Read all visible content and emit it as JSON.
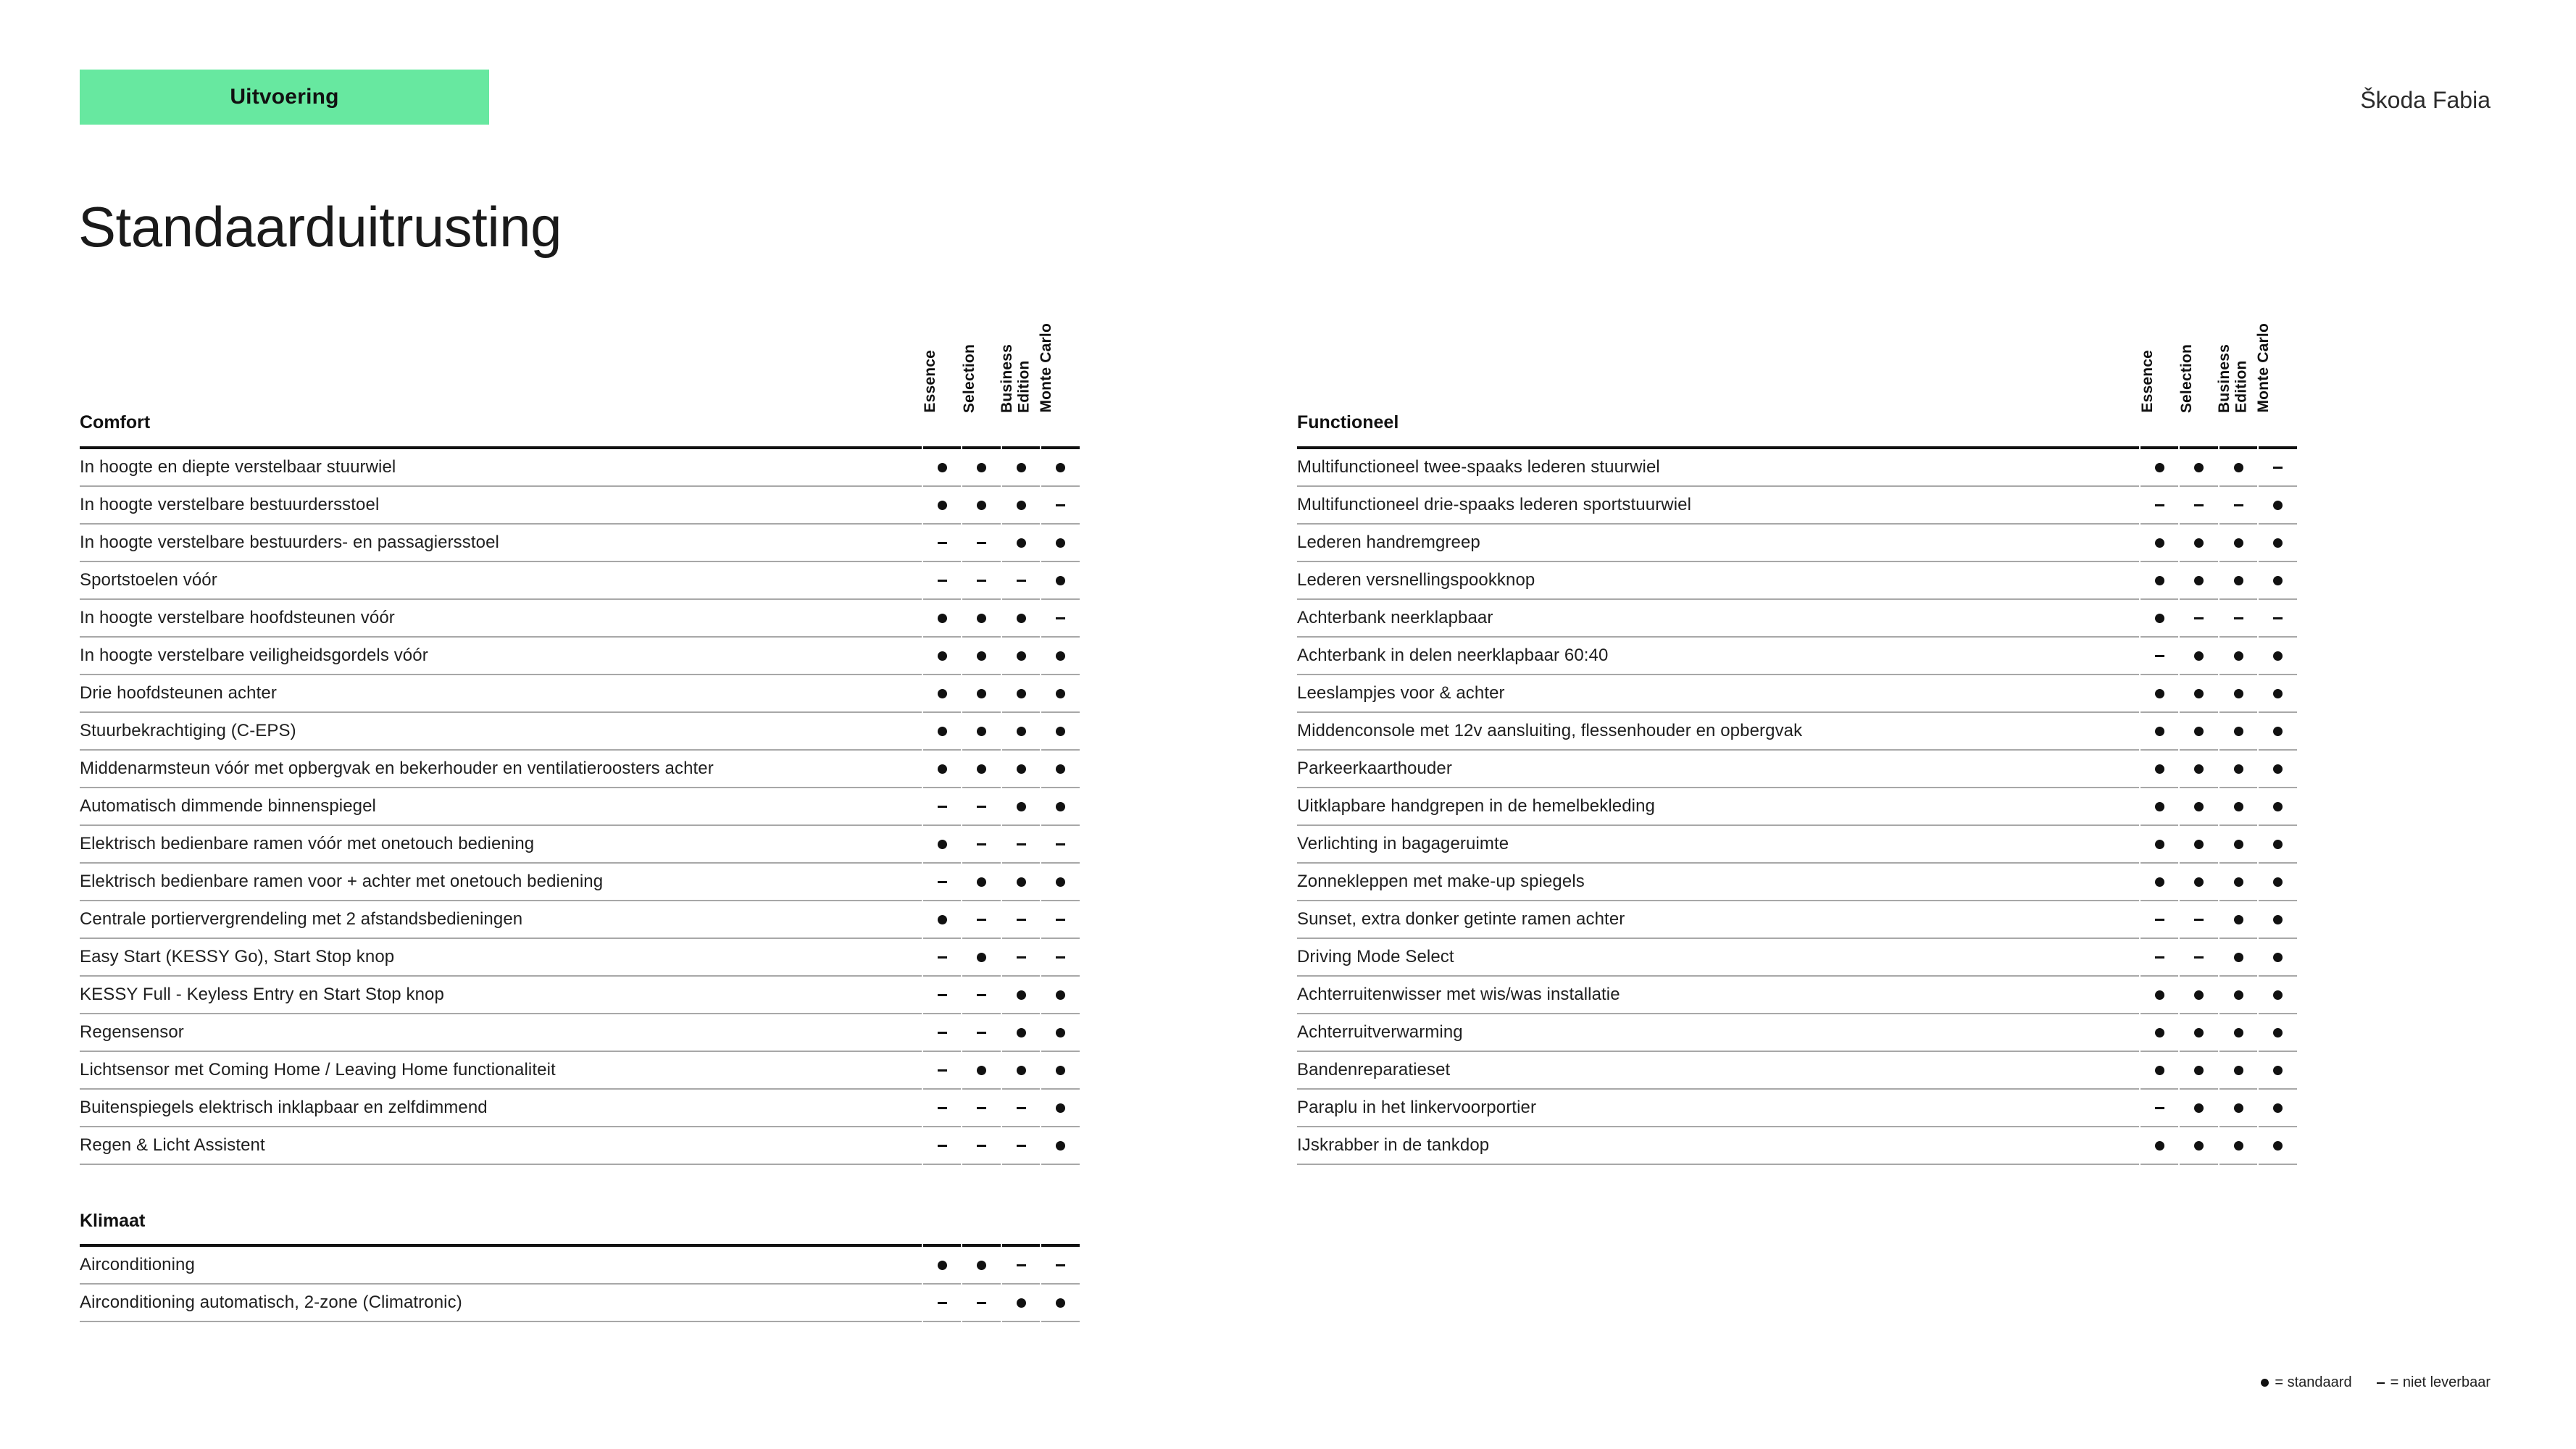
{
  "header": {
    "badge_label": "Uitvoering",
    "badge_color": "#67e8a0",
    "page_title": "Standaarduitrusting",
    "model_name": "Škoda Fabia"
  },
  "variants": [
    "Essence",
    "Selection",
    "Business\nEdition",
    "Monte Carlo"
  ],
  "legend": {
    "standard_text": "= standaard",
    "unavailable_text": "= niet leverbaar"
  },
  "columns": {
    "left": [
      {
        "title": "Comfort",
        "rows": [
          {
            "label": "In hoogte en diepte verstelbaar stuurwiel",
            "marks": [
              "dot",
              "dot",
              "dot",
              "dot"
            ]
          },
          {
            "label": "In hoogte verstelbare bestuurdersstoel",
            "marks": [
              "dot",
              "dot",
              "dot",
              "dash"
            ]
          },
          {
            "label": "In hoogte verstelbare bestuurders- en passagiersstoel",
            "marks": [
              "dash",
              "dash",
              "dot",
              "dot"
            ]
          },
          {
            "label": "Sportstoelen vóór",
            "marks": [
              "dash",
              "dash",
              "dash",
              "dot"
            ]
          },
          {
            "label": "In hoogte verstelbare hoofdsteunen vóór",
            "marks": [
              "dot",
              "dot",
              "dot",
              "dash"
            ]
          },
          {
            "label": "In hoogte verstelbare veiligheidsgordels vóór",
            "marks": [
              "dot",
              "dot",
              "dot",
              "dot"
            ]
          },
          {
            "label": "Drie hoofdsteunen achter",
            "marks": [
              "dot",
              "dot",
              "dot",
              "dot"
            ]
          },
          {
            "label": "Stuurbekrachtiging (C-EPS)",
            "marks": [
              "dot",
              "dot",
              "dot",
              "dot"
            ]
          },
          {
            "label": "Middenarmsteun vóór met opbergvak en bekerhouder en ventilatieroosters achter",
            "marks": [
              "dot",
              "dot",
              "dot",
              "dot"
            ]
          },
          {
            "label": "Automatisch dimmende binnenspiegel",
            "marks": [
              "dash",
              "dash",
              "dot",
              "dot"
            ]
          },
          {
            "label": "Elektrisch bedienbare ramen vóór met onetouch bediening",
            "marks": [
              "dot",
              "dash",
              "dash",
              "dash"
            ]
          },
          {
            "label": "Elektrisch bedienbare ramen voor + achter met onetouch bediening",
            "marks": [
              "dash",
              "dot",
              "dot",
              "dot"
            ]
          },
          {
            "label": "Centrale portiervergrendeling met 2 afstandsbedieningen",
            "marks": [
              "dot",
              "dash",
              "dash",
              "dash"
            ]
          },
          {
            "label": "Easy Start (KESSY Go), Start Stop knop",
            "marks": [
              "dash",
              "dot",
              "dash",
              "dash"
            ]
          },
          {
            "label": "KESSY Full - Keyless Entry en Start Stop knop",
            "marks": [
              "dash",
              "dash",
              "dot",
              "dot"
            ]
          },
          {
            "label": "Regensensor",
            "marks": [
              "dash",
              "dash",
              "dot",
              "dot"
            ]
          },
          {
            "label": "Lichtsensor met Coming Home / Leaving Home functionaliteit",
            "marks": [
              "dash",
              "dot",
              "dot",
              "dot"
            ]
          },
          {
            "label": "Buitenspiegels elektrisch inklapbaar en zelfdimmend",
            "marks": [
              "dash",
              "dash",
              "dash",
              "dot"
            ]
          },
          {
            "label": "Regen & Licht Assistent",
            "marks": [
              "dash",
              "dash",
              "dash",
              "dot"
            ]
          }
        ]
      },
      {
        "title": "Klimaat",
        "rows": [
          {
            "label": "Airconditioning",
            "marks": [
              "dot",
              "dot",
              "dash",
              "dash"
            ]
          },
          {
            "label": "Airconditioning automatisch, 2-zone (Climatronic)",
            "marks": [
              "dash",
              "dash",
              "dot",
              "dot"
            ]
          }
        ]
      }
    ],
    "right": [
      {
        "title": "Functioneel",
        "rows": [
          {
            "label": "Multifunctioneel twee-spaaks lederen stuurwiel",
            "marks": [
              "dot",
              "dot",
              "dot",
              "dash"
            ]
          },
          {
            "label": "Multifunctioneel drie-spaaks lederen sportstuurwiel",
            "marks": [
              "dash",
              "dash",
              "dash",
              "dot"
            ]
          },
          {
            "label": "Lederen handremgreep",
            "marks": [
              "dot",
              "dot",
              "dot",
              "dot"
            ]
          },
          {
            "label": "Lederen versnellingspookknop",
            "marks": [
              "dot",
              "dot",
              "dot",
              "dot"
            ]
          },
          {
            "label": "Achterbank neerklapbaar",
            "marks": [
              "dot",
              "dash",
              "dash",
              "dash"
            ]
          },
          {
            "label": "Achterbank in delen neerklapbaar 60:40",
            "marks": [
              "dash",
              "dot",
              "dot",
              "dot"
            ]
          },
          {
            "label": "Leeslampjes voor & achter",
            "marks": [
              "dot",
              "dot",
              "dot",
              "dot"
            ]
          },
          {
            "label": "Middenconsole met 12v aansluiting, flessenhouder en opbergvak",
            "marks": [
              "dot",
              "dot",
              "dot",
              "dot"
            ]
          },
          {
            "label": "Parkeerkaarthouder",
            "marks": [
              "dot",
              "dot",
              "dot",
              "dot"
            ]
          },
          {
            "label": "Uitklapbare handgrepen in de hemelbekleding",
            "marks": [
              "dot",
              "dot",
              "dot",
              "dot"
            ]
          },
          {
            "label": "Verlichting in bagageruimte",
            "marks": [
              "dot",
              "dot",
              "dot",
              "dot"
            ]
          },
          {
            "label": "Zonnekleppen met make-up spiegels",
            "marks": [
              "dot",
              "dot",
              "dot",
              "dot"
            ]
          },
          {
            "label": "Sunset, extra donker getinte ramen achter",
            "marks": [
              "dash",
              "dash",
              "dot",
              "dot"
            ]
          },
          {
            "label": "Driving Mode Select",
            "marks": [
              "dash",
              "dash",
              "dot",
              "dot"
            ]
          },
          {
            "label": "Achterruitenwisser met wis/was installatie",
            "marks": [
              "dot",
              "dot",
              "dot",
              "dot"
            ]
          },
          {
            "label": "Achterruitverwarming",
            "marks": [
              "dot",
              "dot",
              "dot",
              "dot"
            ]
          },
          {
            "label": "Bandenreparatieset",
            "marks": [
              "dot",
              "dot",
              "dot",
              "dot"
            ]
          },
          {
            "label": "Paraplu in het linkervoorportier",
            "marks": [
              "dash",
              "dot",
              "dot",
              "dot"
            ]
          },
          {
            "label": "IJskrabber in de tankdop",
            "marks": [
              "dot",
              "dot",
              "dot",
              "dot"
            ]
          }
        ]
      }
    ]
  }
}
